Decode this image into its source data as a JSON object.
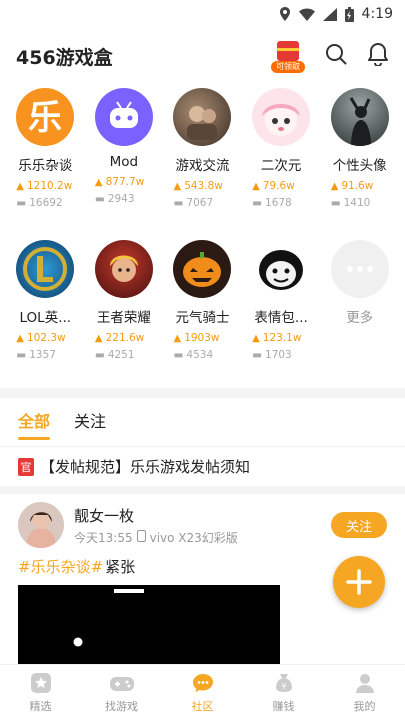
{
  "status": {
    "time": "4:19"
  },
  "header": {
    "title": "456游戏盒",
    "gift_label": "可领取"
  },
  "categories": [
    {
      "name": "乐乐杂谈",
      "hot": "1210.2w",
      "posts": "16692",
      "icon": "le-logo-icon"
    },
    {
      "name": "Mod",
      "hot": "877.7w",
      "posts": "2943",
      "icon": "gamepad-icon"
    },
    {
      "name": "游戏交流",
      "hot": "543.8w",
      "posts": "7067",
      "icon": "photo-avatar"
    },
    {
      "name": "二次元",
      "hot": "79.6w",
      "posts": "1678",
      "icon": "anime-avatar"
    },
    {
      "name": "个性头像",
      "hot": "91.6w",
      "posts": "1410",
      "icon": "silhouette-avatar"
    },
    {
      "name": "LOL英...",
      "hot": "102.3w",
      "posts": "1357",
      "icon": "lol-logo-icon"
    },
    {
      "name": "王者荣耀",
      "hot": "221.6w",
      "posts": "4251",
      "icon": "hero-avatar"
    },
    {
      "name": "元气骑士",
      "hot": "1903w",
      "posts": "4534",
      "icon": "pumpkin-avatar"
    },
    {
      "name": "表情包...",
      "hot": "123.1w",
      "posts": "1703",
      "icon": "meme-avatar"
    },
    {
      "name": "更多",
      "icon": "more-icon"
    }
  ],
  "tabs": [
    {
      "label": "全部",
      "active": true
    },
    {
      "label": "关注",
      "active": false
    }
  ],
  "notice": {
    "badge": "官",
    "text": "【发帖规范】乐乐游戏发帖须知"
  },
  "post": {
    "user": "靓女一枚",
    "time": "今天13:55",
    "device": "vivo X23幻彩版",
    "follow_label": "关注",
    "tag": "#乐乐杂谈#",
    "topic": "紧张"
  },
  "bottom_nav": [
    {
      "label": "精选",
      "icon": "star-icon",
      "active": false
    },
    {
      "label": "找游戏",
      "icon": "gamepad-icon",
      "active": false
    },
    {
      "label": "社区",
      "icon": "chat-icon",
      "active": true
    },
    {
      "label": "赚钱",
      "icon": "money-bag-icon",
      "active": false
    },
    {
      "label": "我的",
      "icon": "person-icon",
      "active": false
    }
  ],
  "colors": {
    "accent": "#f5a623",
    "badge": "#e53935"
  }
}
